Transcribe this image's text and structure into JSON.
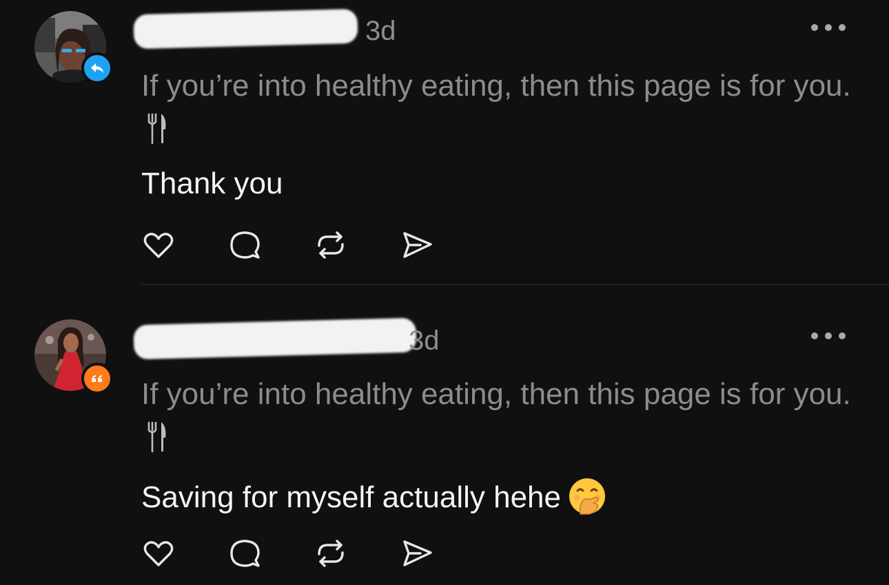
{
  "posts": [
    {
      "time": "3d",
      "avatar_icon": "avatar-photo",
      "badge_icon": "reply-arrow-icon",
      "badge_color": "#1fa2f1",
      "quote_text": "If you’re into healthy eating, then this page is for you.",
      "quote_emoji": "fork-and-knife-icon",
      "reply_text": "Thank you"
    },
    {
      "time": "3d",
      "avatar_icon": "avatar-photo",
      "badge_icon": "quote-icon",
      "badge_color": "#ff7a1a",
      "quote_text": "If you’re into healthy eating, then this page is for you.",
      "quote_emoji": "fork-and-knife-icon",
      "reply_text": "Saving for myself actually hehe",
      "reply_emoji": "face-with-hand-over-mouth-icon"
    }
  ],
  "actions": [
    "heart-icon",
    "comment-icon",
    "repost-icon",
    "share-icon"
  ],
  "colors": {
    "background": "#101010",
    "secondary_text": "#8c8c8c",
    "primary_text": "#f4f4f4",
    "divider": "#2e2e2e"
  }
}
